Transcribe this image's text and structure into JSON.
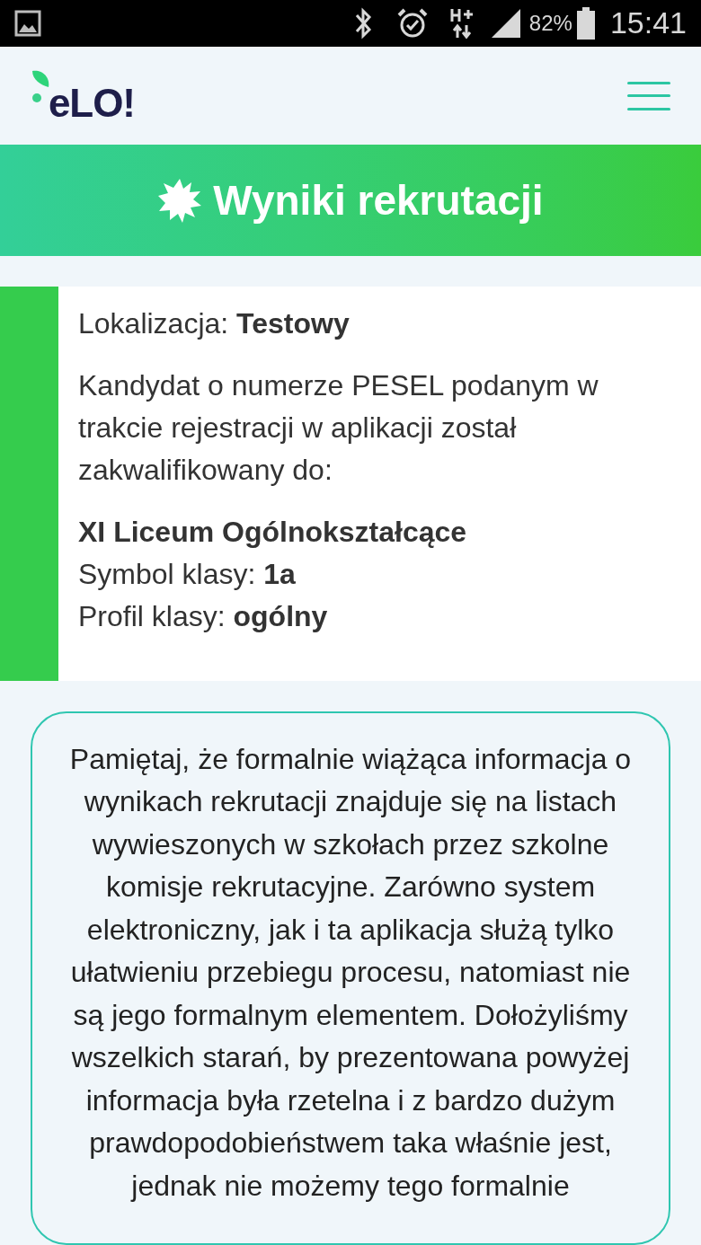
{
  "status_bar": {
    "battery": "82%",
    "time": "15:41"
  },
  "header": {
    "logo": "eLO!"
  },
  "banner": {
    "title": "Wyniki rekrutacji"
  },
  "result_card": {
    "location": "Lokalizacja: **Testowy**",
    "message": "Kandydat o numerze PESEL podanym w trakcie rejestracji w aplikacji został zakwalifikowany do:",
    "school": "XI Liceum Ogólnokształcące",
    "class_symbol": "Symbol klasy: **1a**",
    "class_profile": "Profil klasy: **ogólny**"
  },
  "notice": {
    "text": "Pamiętaj, że formalnie wiążąca informacja o wynikach rekrutacji znajduje się na listach wywieszonych w szkołach przez szkolne komisje rekrutacyjne. Zarówno system elektroniczny, jak i ta aplikacja służą tylko ułatwieniu przebiegu procesu, natomiast nie są jego formalnym elementem. Dołożyliśmy wszelkich starań, by prezentowana powyżej informacja była rzetelna i z bardzo dużym prawdopodobieństwem taka właśnie jest, jednak nie możemy tego formalnie"
  }
}
